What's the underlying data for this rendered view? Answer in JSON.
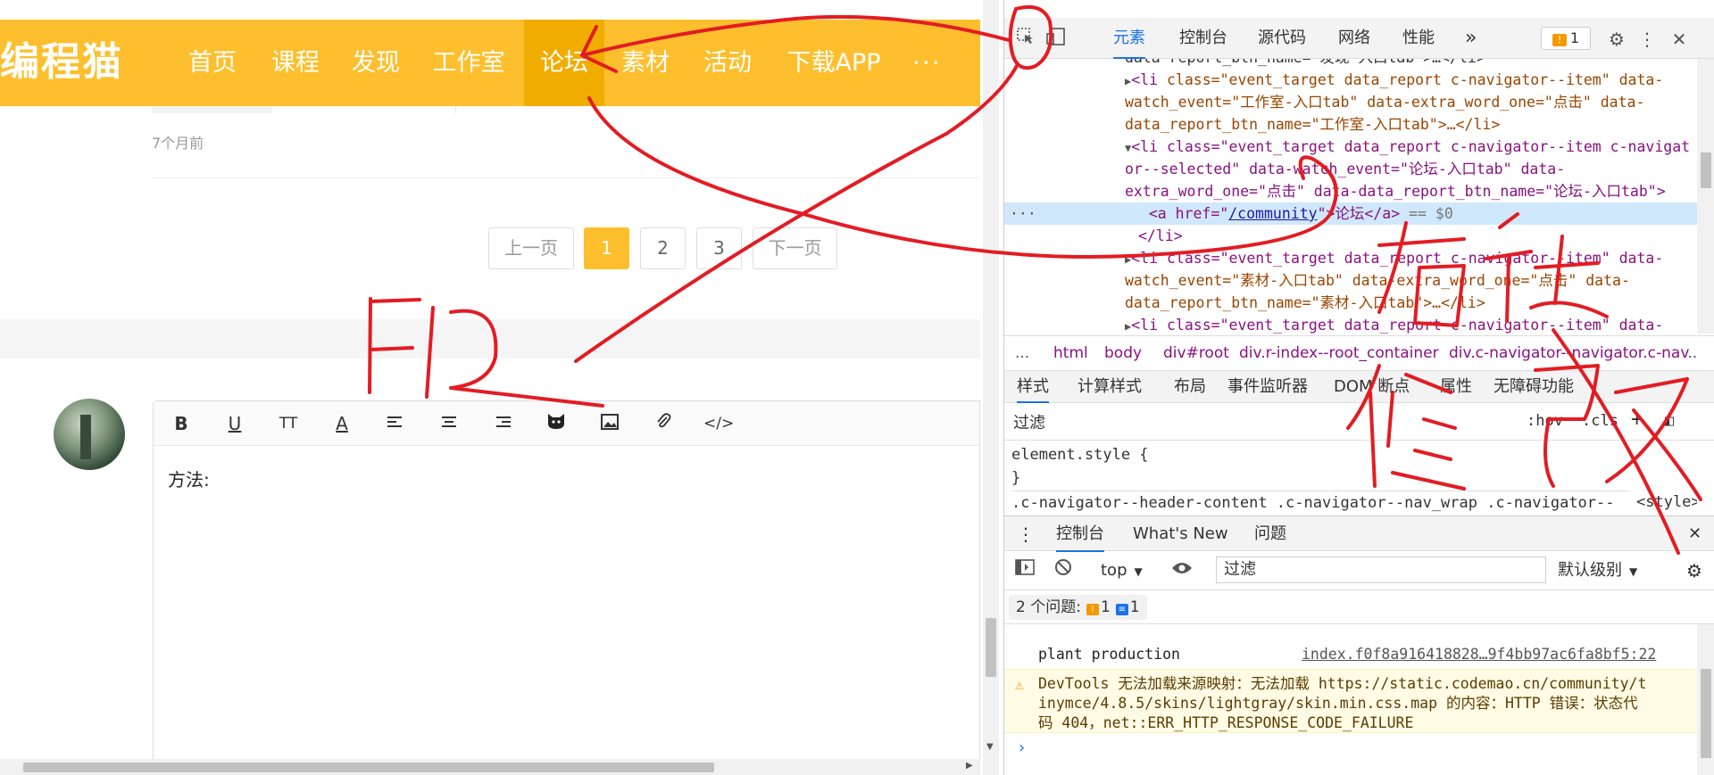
{
  "page": {
    "logo": "编程猫",
    "nav": [
      {
        "label": "首页"
      },
      {
        "label": "课程"
      },
      {
        "label": "发现"
      },
      {
        "label": "工作室"
      },
      {
        "label": "论坛",
        "selected": true
      },
      {
        "label": "素材"
      },
      {
        "label": "活动"
      },
      {
        "label": "下载APP"
      }
    ],
    "nav_more": "···",
    "time_ago": "7个月前",
    "pagination": {
      "prev": "上一页",
      "pages": [
        "1",
        "2",
        "3"
      ],
      "current": "1",
      "next": "下一页"
    },
    "editor": {
      "tools": [
        "bold-icon",
        "underline-icon",
        "text-size-icon",
        "font-color-icon",
        "align-left-icon",
        "align-center-icon",
        "align-right-icon",
        "cat-emoji-icon",
        "image-icon",
        "attachment-icon",
        "code-icon"
      ],
      "tool_glyphs": {
        "bold": "B",
        "underline": "U",
        "text_size": "TT",
        "font_color": "A",
        "code": "</>"
      },
      "content": "方法:"
    }
  },
  "devtools": {
    "tabs": [
      "元素",
      "控制台",
      "源代码",
      "网络",
      "性能"
    ],
    "active_tab": "元素",
    "more_tabs": "»",
    "issues_badge": "1",
    "elements": {
      "line0": "data-report_btn_name=\"发现-入口tab\">…</li>",
      "line1_tag": "<li",
      "line1_attr": " class=\"event_target data_report c-navigator--item\" data-",
      "line2": "watch_event=\"工作室-入口tab\" data-extra_word_one=\"点击\" data-",
      "line3": "data_report_btn_name=\"工作室-入口tab\">…</li>",
      "line4": "<li class=\"event_target data_report c-navigator--item c-navigat",
      "line5": "or--selected\" data-watch_event=\"论坛-入口tab\" data-",
      "line6": "extra_word_one=\"点击\" data-data_report_btn_name=\"论坛-入口tab\">",
      "sel_dots": "···",
      "sel_open": "<a href=\"",
      "sel_href": "/community",
      "sel_close": "\">论坛</a>",
      "sel_eq": " == $0",
      "line8": "</li>",
      "line9": "<li class=\"event_target data_report c-navigator--item\" data-",
      "line10": "watch_event=\"素材-入口tab\" data-extra_word_one=\"点击\" data-",
      "line11": "data_report_btn_name=\"素材-入口tab\">…</li>",
      "line12": "<li class=\"event_target data_report c-navigator--item\" data-"
    },
    "breadcrumbs": [
      "...",
      "html",
      "body",
      "div#root",
      "div.r-index--root_container",
      "div.c-navigator--navigator.c-nav",
      "..."
    ],
    "styles_tabs": [
      "样式",
      "计算样式",
      "布局",
      "事件监听器",
      "DOM 断点",
      "属性",
      "无障碍功能"
    ],
    "styles_filter": "过滤",
    "styles_hov": ":hov",
    "styles_cls": ".cls",
    "styles_plus": "+",
    "styles_rules": {
      "l1": "element.style {",
      "l2": "}",
      "l3": ".c-navigator--header-content .c-navigator--nav_wrap .c-navigator--",
      "l3_src": "<style>"
    },
    "drawer_tabs": [
      "控制台",
      "What's New",
      "问题"
    ],
    "console": {
      "context": "top",
      "filter": "过滤",
      "level": "默认级别",
      "issues_label": "2 个问题:",
      "issues_warn": "1",
      "issues_info": "1",
      "log_text": "plant production",
      "log_source": "index.f0f8a916418828…9f4bb97ac6fa8bf5:22",
      "warn_line1": "DevTools 无法加载来源映射：无法加载 https://static.codemao.cn/community/t",
      "warn_line2": "inymce/4.8.5/skins/lightgray/skin.min.css.map 的内容：HTTP 错误：状态代",
      "warn_line3": "码 404，net::ERR_HTTP_RESPONSE_CODE_FAILURE",
      "prompt": "›"
    }
  },
  "annotations": {
    "f12": "F12",
    "right_click": "右键",
    "modify": "修改",
    "color": "#e31c23"
  }
}
